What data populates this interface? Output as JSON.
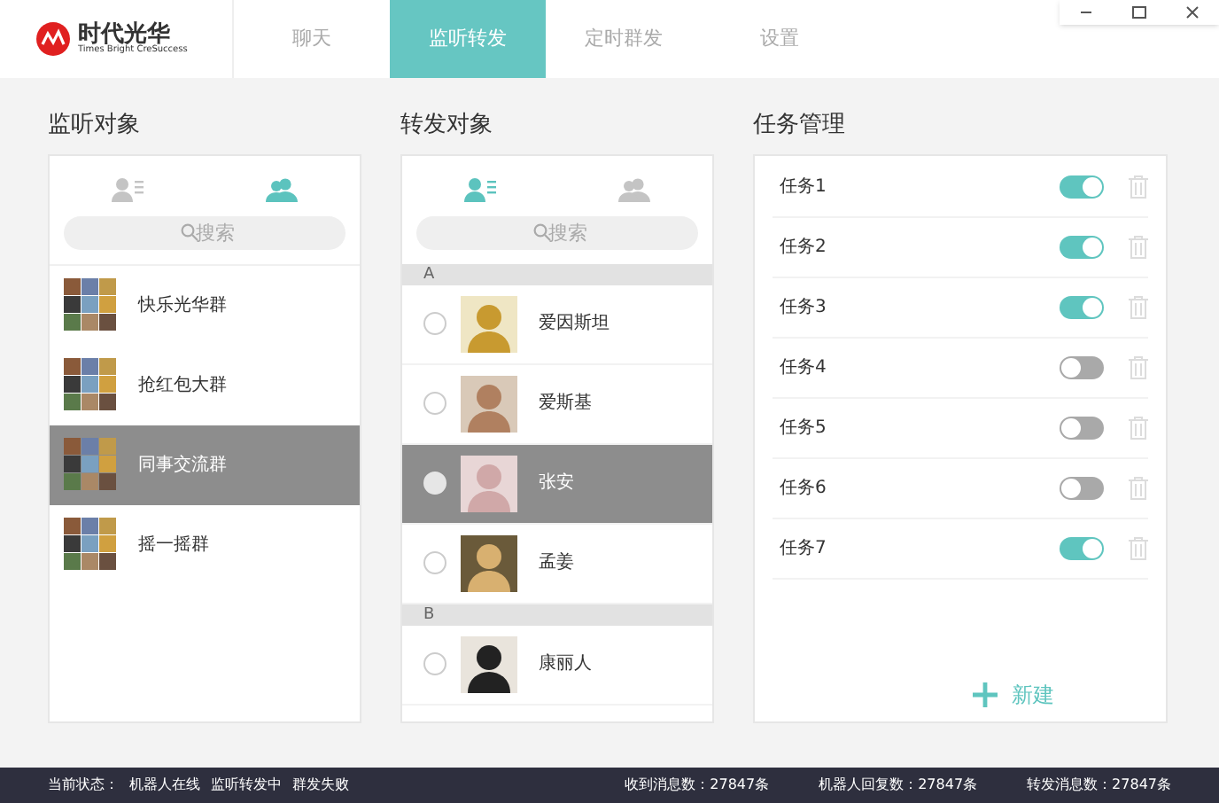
{
  "logo": {
    "name": "时代光华",
    "slogan": "Times Bright CreSuccess"
  },
  "tabs": [
    {
      "label": "聊天",
      "selected": false
    },
    {
      "label": "监听转发",
      "selected": true
    },
    {
      "label": "定时群发",
      "selected": false
    },
    {
      "label": "设置",
      "selected": false
    }
  ],
  "monitor": {
    "title": "监听对象",
    "views": [
      {
        "kind": "contacts",
        "selected": false
      },
      {
        "kind": "groups",
        "selected": true
      }
    ],
    "search": {
      "placeholder": "搜索"
    },
    "items": [
      {
        "name": "快乐光华群",
        "selected": false
      },
      {
        "name": "抢红包大群",
        "selected": false
      },
      {
        "name": "同事交流群",
        "selected": true
      },
      {
        "name": "摇一摇群",
        "selected": false
      }
    ]
  },
  "forward": {
    "title": "转发对象",
    "views": [
      {
        "kind": "contacts",
        "selected": true
      },
      {
        "kind": "groups",
        "selected": false
      }
    ],
    "search": {
      "placeholder": "搜索"
    },
    "sections": [
      {
        "letter": "A",
        "contacts": [
          {
            "name": "爱因斯坦",
            "selected": false
          },
          {
            "name": "爱斯基",
            "selected": false
          },
          {
            "name": "张安",
            "selected": true
          },
          {
            "name": "孟姜",
            "selected": false
          }
        ]
      },
      {
        "letter": "B",
        "contacts": [
          {
            "name": "康丽人",
            "selected": false
          }
        ]
      }
    ]
  },
  "tasks": {
    "title": "任务管理",
    "items": [
      {
        "name": "任务1",
        "on": true
      },
      {
        "name": "任务2",
        "on": true
      },
      {
        "name": "任务3",
        "on": true
      },
      {
        "name": "任务4",
        "on": false
      },
      {
        "name": "任务5",
        "on": false
      },
      {
        "name": "任务6",
        "on": false
      },
      {
        "name": "任务7",
        "on": true
      }
    ],
    "new_button": "新建"
  },
  "status_bar": {
    "state_label": "当前状态：",
    "states": [
      "机器人在线",
      "监听转发中",
      "群发失败"
    ],
    "stats": [
      "收到消息数：27847条",
      "机器人回复数：27847条",
      "转发消息数：27847条"
    ]
  }
}
